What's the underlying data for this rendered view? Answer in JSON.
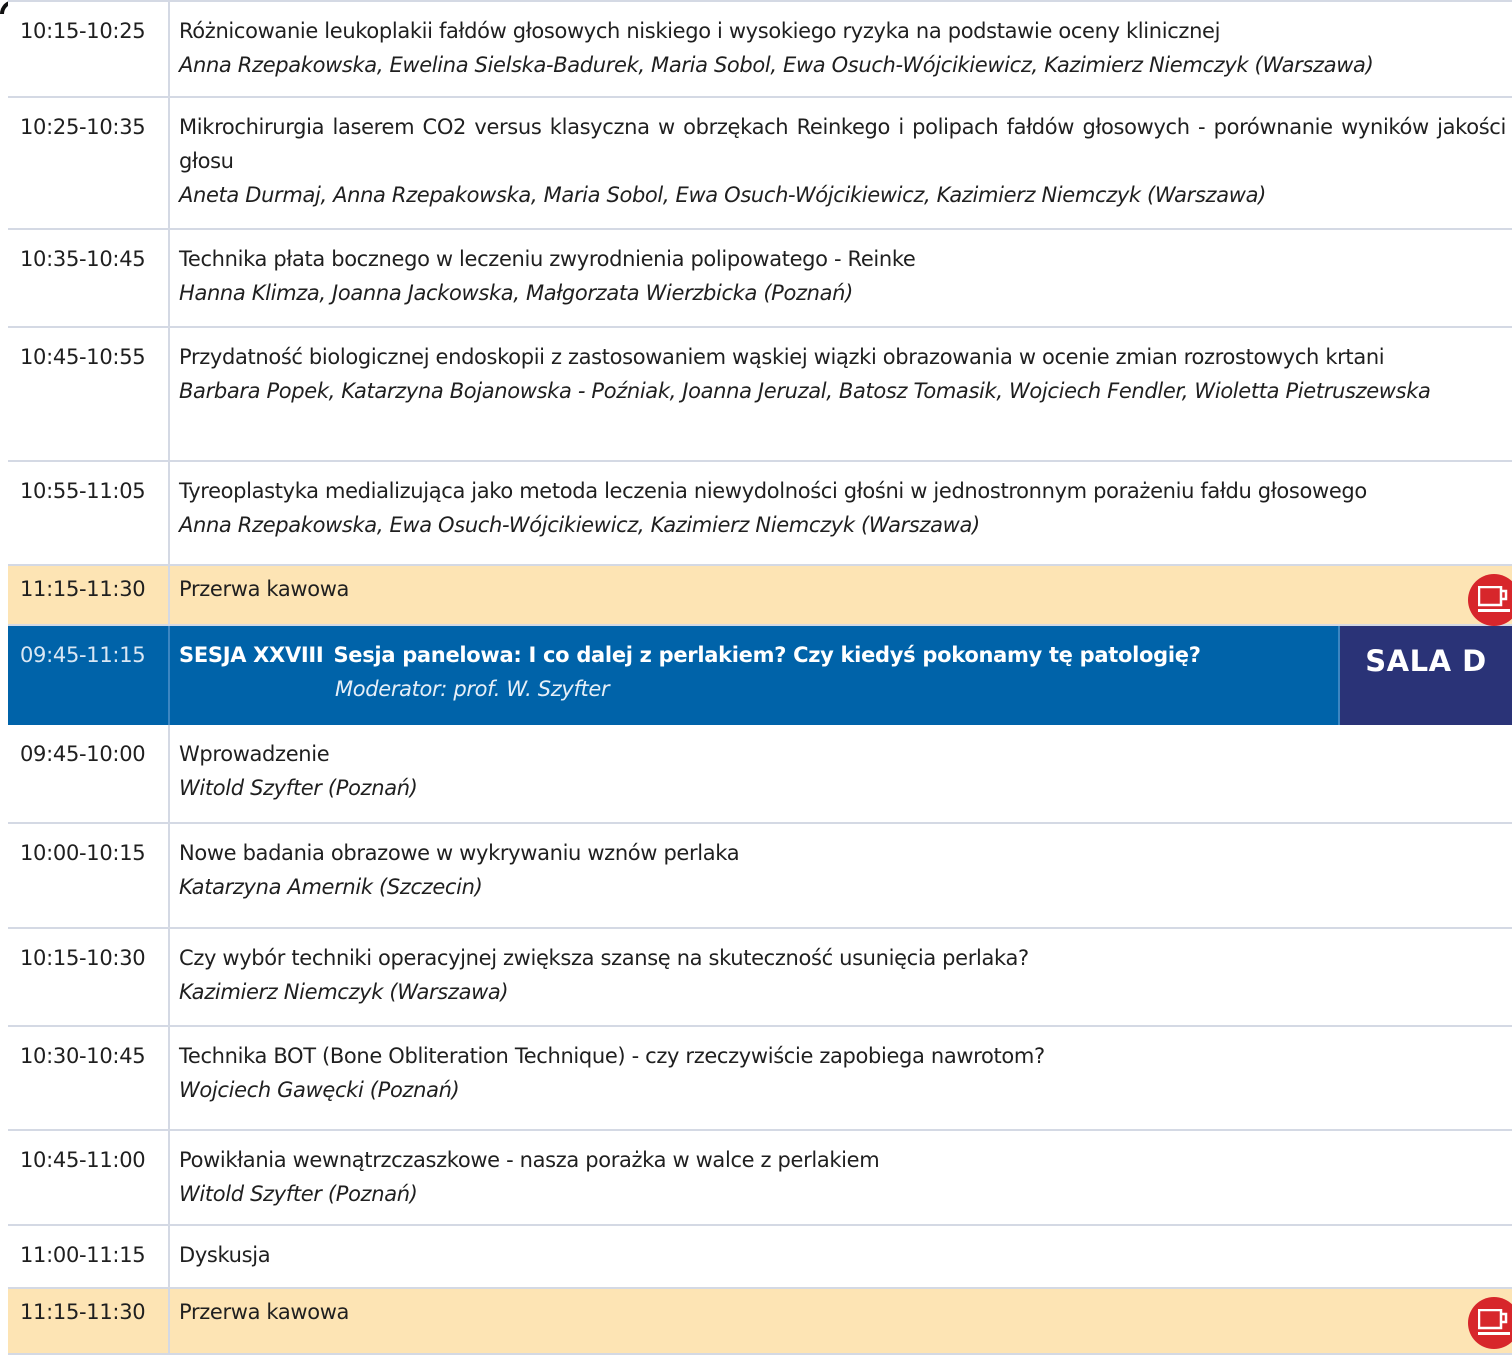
{
  "block1": [
    {
      "time": "10:15-10:25",
      "title": "Różnicowanie leukoplakii fałdów głosowych niskiego i wysokiego ryzyka na podstawie oceny klinicznej",
      "authors": "Anna Rzepakowska, Ewelina Sielska-Badurek, Maria Sobol, Ewa Osuch-Wójcikiewicz, Kazimierz Niemczyk (Warszawa)"
    },
    {
      "time": "10:25-10:35",
      "title": "Mikrochirurgia laserem CO2 versus klasyczna w obrzękach Reinkego i polipach fałdów głosowych - porównanie wyników jakości głosu",
      "authors": "Aneta Durmaj, Anna Rzepakowska, Maria Sobol, Ewa Osuch-Wójcikiewicz, Kazimierz Niemczyk (Warszawa)"
    },
    {
      "time": "10:35-10:45",
      "title": "Technika płata bocznego w leczeniu zwyrodnienia polipowatego - Reinke",
      "authors": "Hanna Klimza, Joanna Jackowska, Małgorzata Wierzbicka (Poznań)"
    },
    {
      "time": "10:45-10:55",
      "title": "Przydatność biologicznej endoskopii z zastosowaniem wąskiej wiązki obrazowania w ocenie zmian rozrostowych krtani",
      "authors": "Barbara Popek, Katarzyna Bojanowska - Poźniak, Joanna Jeruzal, Batosz Tomasik, Wojciech Fendler, Wioletta Pietruszewska"
    },
    {
      "time": "10:55-11:05",
      "title": "Tyreoplastyka medializująca jako metoda leczenia niewydolności głośni w jednostronnym porażeniu fałdu głosowego",
      "authors": "Anna Rzepakowska, Ewa Osuch-Wójcikiewicz, Kazimierz Niemczyk (Warszawa)"
    }
  ],
  "break1": {
    "time": "11:15-11:30",
    "label": "Przerwa kawowa"
  },
  "session": {
    "time": "09:45-11:15",
    "code": "SESJA XXVIII",
    "title": "Sesja panelowa: I co dalej z perlakiem? Czy kiedyś pokonamy tę patologię?",
    "moderator": "Moderator: prof. W. Szyfter",
    "room": "SALA D"
  },
  "block2": [
    {
      "time": "09:45-10:00",
      "title": "Wprowadzenie",
      "authors": "Witold Szyfter (Poznań)"
    },
    {
      "time": "10:00-10:15",
      "title": "Nowe badania obrazowe w wykrywaniu wznów perlaka",
      "authors": "Katarzyna Amernik (Szczecin)"
    },
    {
      "time": "10:15-10:30",
      "title": "Czy wybór techniki operacyjnej zwiększa szansę na skuteczność usunięcia perlaka?",
      "authors": "Kazimierz Niemczyk (Warszawa)"
    },
    {
      "time": "10:30-10:45",
      "title": "Technika BOT (Bone Obliteration Technique) - czy rzeczywiście zapobiega nawrotom?",
      "authors": "Wojciech Gawęcki (Poznań)"
    },
    {
      "time": "10:45-11:00",
      "title": "Powikłania wewnątrzczaszkowe - nasza porażka w walce z perlakiem",
      "authors": "Witold Szyfter (Poznań)"
    }
  ],
  "discussion": {
    "time": "11:00-11:15",
    "title": "Dyskusja"
  },
  "break2": {
    "time": "11:15-11:30",
    "label": "Przerwa kawowa"
  },
  "icons": {
    "coffee": "coffee-cup-icon"
  },
  "colors": {
    "session_bg": "#0063a9",
    "room_bg": "#2a3377",
    "break_bg": "#fde4b4",
    "coffee_badge": "#d7262b"
  }
}
